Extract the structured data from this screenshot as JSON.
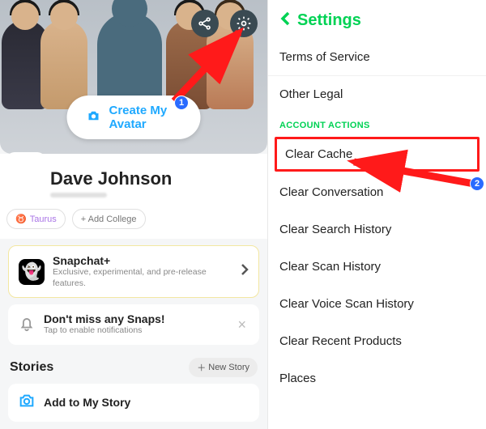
{
  "left": {
    "create_avatar": "Create My Avatar",
    "name": "Dave Johnson",
    "zodiac": "Taurus",
    "add_college": "+ Add College",
    "plus": {
      "title": "Snapchat+",
      "subtitle": "Exclusive, experimental, and pre-release features."
    },
    "notify": {
      "title": "Don't miss any Snaps!",
      "subtitle": "Tap to enable notifications"
    },
    "stories_header_suffix": " Stories",
    "new_story": "New Story",
    "add_story": "Add to My Story"
  },
  "right": {
    "title": "Settings",
    "items_top": [
      "Terms of Service",
      "Other Legal"
    ],
    "section": "ACCOUNT ACTIONS",
    "items_actions": [
      "Clear Cache",
      "Clear Conversation",
      "Clear Search History",
      "Clear Scan History",
      "Clear Voice Scan History",
      "Clear Recent Products",
      "Places"
    ]
  },
  "annotations": {
    "one": "1",
    "two": "2"
  }
}
